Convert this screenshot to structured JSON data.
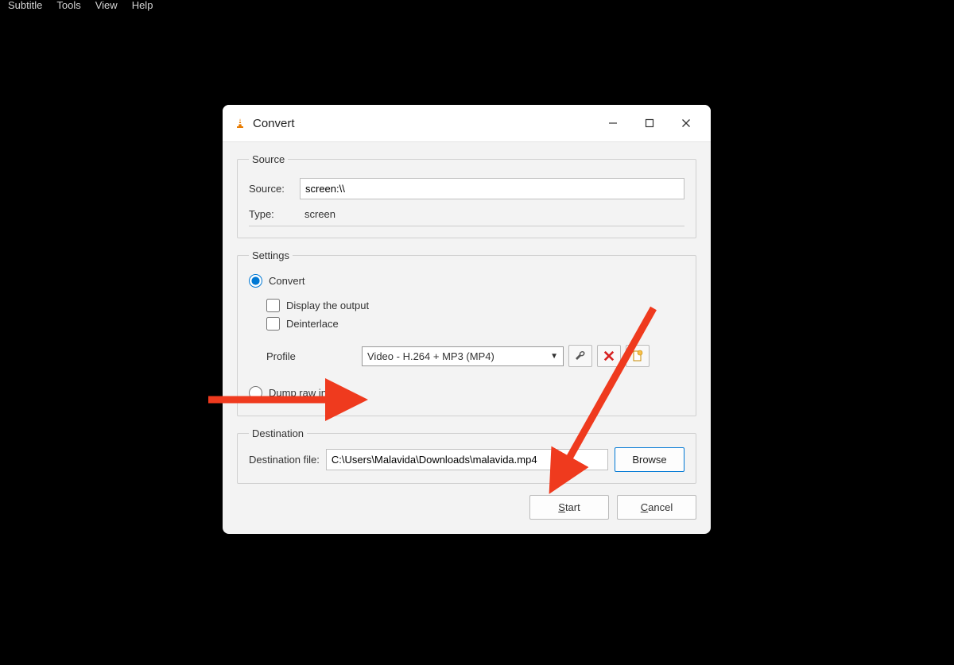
{
  "menubar": {
    "items": [
      "Subtitle",
      "Tools",
      "View",
      "Help"
    ]
  },
  "dialog": {
    "title": "Convert",
    "source": {
      "legend": "Source",
      "source_label": "Source:",
      "source_value": "screen:\\\\",
      "type_label": "Type:",
      "type_value": "screen"
    },
    "settings": {
      "legend": "Settings",
      "convert_label": "Convert",
      "display_output_label": "Display the output",
      "deinterlace_label": "Deinterlace",
      "profile_label": "Profile",
      "profile_value": "Video - H.264 + MP3 (MP4)",
      "dump_raw_label": "Dump raw input"
    },
    "destination": {
      "legend": "Destination",
      "file_label": "Destination file:",
      "file_value": "C:\\Users\\Malavida\\Downloads\\malavida.mp4",
      "browse_label": "Browse"
    },
    "actions": {
      "start_label": "Start",
      "cancel_label": "Cancel"
    }
  }
}
